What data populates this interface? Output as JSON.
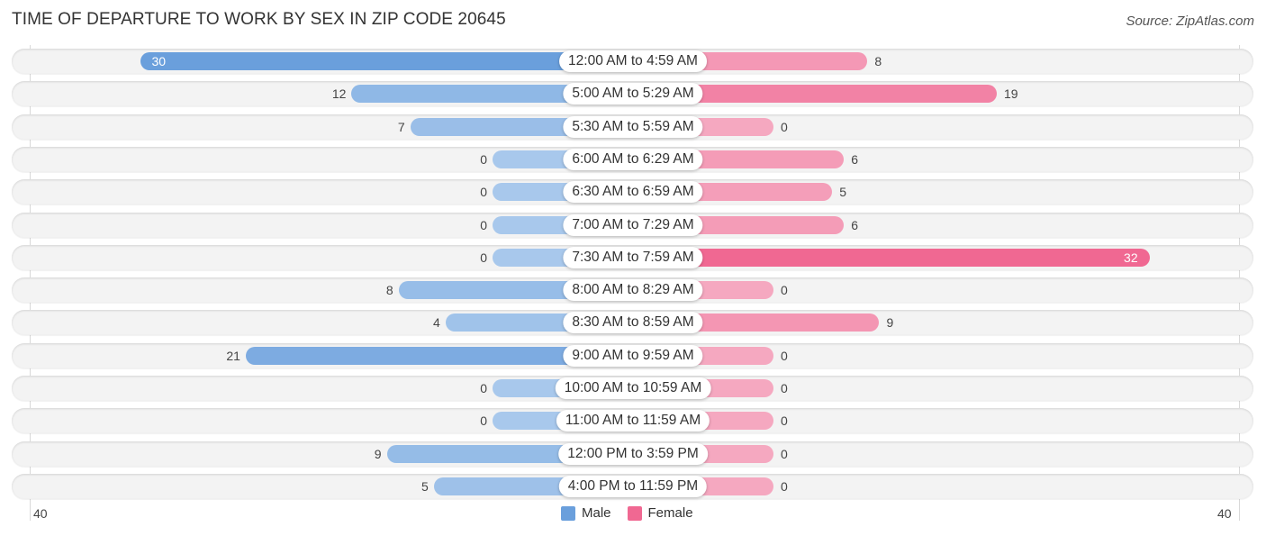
{
  "header": {
    "title": "TIME OF DEPARTURE TO WORK BY SEX IN ZIP CODE 20645",
    "source": "Source: ZipAtlas.com"
  },
  "colors": {
    "male": "#6a9fdc",
    "male_light": "#a8c8ec",
    "female": "#f06892",
    "female_light": "#f5a8c0",
    "row_background": "#f3f3f3"
  },
  "chart_data": {
    "type": "bar",
    "orientation": "horizontal-diverging",
    "title": "TIME OF DEPARTURE TO WORK BY SEX IN ZIP CODE 20645",
    "categories": [
      "12:00 AM to 4:59 AM",
      "5:00 AM to 5:29 AM",
      "5:30 AM to 5:59 AM",
      "6:00 AM to 6:29 AM",
      "6:30 AM to 6:59 AM",
      "7:00 AM to 7:29 AM",
      "7:30 AM to 7:59 AM",
      "8:00 AM to 8:29 AM",
      "8:30 AM to 8:59 AM",
      "9:00 AM to 9:59 AM",
      "10:00 AM to 10:59 AM",
      "11:00 AM to 11:59 AM",
      "12:00 PM to 3:59 PM",
      "4:00 PM to 11:59 PM"
    ],
    "series": [
      {
        "name": "Male",
        "values": [
          30,
          12,
          7,
          0,
          0,
          0,
          0,
          8,
          4,
          21,
          0,
          0,
          9,
          5
        ]
      },
      {
        "name": "Female",
        "values": [
          8,
          19,
          0,
          6,
          5,
          6,
          32,
          0,
          9,
          0,
          0,
          0,
          0,
          0
        ]
      }
    ],
    "xlim": [
      -40,
      40
    ],
    "axis_ticks": {
      "left": "40",
      "right": "40"
    },
    "legend": {
      "placement": "bottom-center",
      "entries": [
        "Male",
        "Female"
      ]
    },
    "xlabel": "",
    "ylabel": "",
    "grid": false
  }
}
